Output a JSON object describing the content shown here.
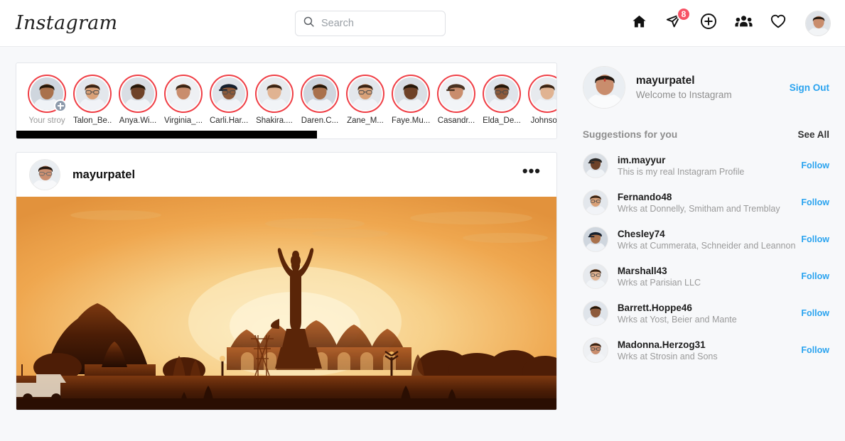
{
  "app": {
    "brand": "Instagram"
  },
  "search": {
    "placeholder": "Search",
    "value": "",
    "icon": "search-icon"
  },
  "nav": {
    "home": "home-icon",
    "messages": "paper-plane-icon",
    "messages_badge": "8",
    "create": "plus-circle-icon",
    "explore_people": "people-icon",
    "activity": "heart-icon",
    "profile": "avatar"
  },
  "stories": [
    {
      "label": "Your stroy",
      "muted": true,
      "add": true
    },
    {
      "label": "Talon_Be...",
      "muted": false,
      "add": false
    },
    {
      "label": "Anya.Wi...",
      "muted": false,
      "add": false
    },
    {
      "label": "Virginia_...",
      "muted": false,
      "add": false
    },
    {
      "label": "Carli.Har...",
      "muted": false,
      "add": false
    },
    {
      "label": "Shakira....",
      "muted": false,
      "add": false
    },
    {
      "label": "Daren.C...",
      "muted": false,
      "add": false
    },
    {
      "label": "Zane_M...",
      "muted": false,
      "add": false
    },
    {
      "label": "Faye.Mu...",
      "muted": false,
      "add": false
    },
    {
      "label": "Casandr...",
      "muted": false,
      "add": false
    },
    {
      "label": "Elda_De...",
      "muted": false,
      "add": false
    },
    {
      "label": "Johnso...",
      "muted": false,
      "add": false
    }
  ],
  "post": {
    "username": "mayurpatel",
    "menu": "•••",
    "image_alt": "Sunset silhouette of a tall statue with raised arms in front of temple domes"
  },
  "sidebar": {
    "me": {
      "username": "mayurpatel",
      "subtitle": "Welcome to Instagram",
      "signout": "Sign Out"
    },
    "suggestions_title": "Suggestions for you",
    "see_all": "See All",
    "follow_label": "Follow",
    "suggestions": [
      {
        "name": "im.mayyur",
        "desc": "This is my real Instagram Profile"
      },
      {
        "name": "Fernando48",
        "desc": "Wrks at Donnelly, Smitham and Tremblay"
      },
      {
        "name": "Chesley74",
        "desc": "Wrks at Cummerata, Schneider and Leannon"
      },
      {
        "name": "Marshall43",
        "desc": "Wrks at Parisian LLC"
      },
      {
        "name": "Barrett.Hoppe46",
        "desc": "Wrks at Yost, Beier and Mante"
      },
      {
        "name": "Madonna.Herzog31",
        "desc": "Wrks at Strosin and Sons"
      }
    ]
  },
  "colors": {
    "link_blue": "#2aa3ef",
    "badge_red": "#f75265",
    "story_ring": "#ef3f46",
    "page_bg": "#f7f8fa",
    "muted_text": "#8e8e8e"
  }
}
